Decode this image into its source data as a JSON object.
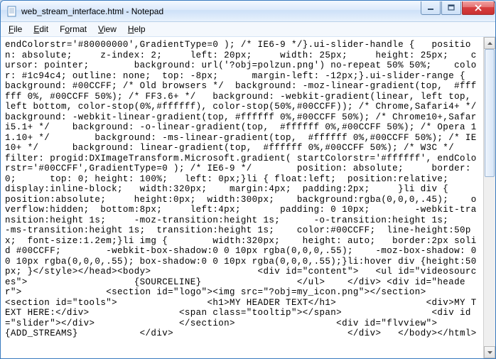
{
  "titlebar": {
    "app_name": "Notepad",
    "file_name": "web_stream_interface.html",
    "separator": " - "
  },
  "menu": {
    "file": "File",
    "edit": "Edit",
    "format": "Format",
    "view": "View",
    "help": "Help"
  },
  "icons": {
    "app": "notepad-icon",
    "minimize": "minimize-icon",
    "maximize": "maximize-icon",
    "close": "close-icon",
    "scroll_up": "scroll-up-arrow",
    "scroll_down": "scroll-down-arrow"
  },
  "editor": {
    "content": "endColorstr='#80000000',GradientType=0 ); /* IE6-9 */}.ui-slider-handle {   position: absolute;     z-index: 2;     left: 20px;     width: 25px;     height: 25px;    cursor: pointer;        background: url('?obj=polzun.png') no-repeat 50% 50%;    color: #1c94c4; outline: none;  top: -8px;      margin-left: -12px;}.ui-slider-range {  background: #00CCFF; /* Old browsers */  background: -moz-linear-gradient(top,  #ffffff 0%, #00CCFF 50%); /* FF3.6+ */   background: -webkit-gradient(linear, left top, left bottom, color-stop(0%,#ffffff), color-stop(50%,#00CCFF)); /* Chrome,Safari4+ */    background: -webkit-linear-gradient(top, #ffffff 0%,#00CCFF 50%); /* Chrome10+,Safari5.1+ */    background: -o-linear-gradient(top,  #ffffff 0%,#00CCFF 50%); /* Opera 11.10+ */        background: -ms-linear-gradient(top,  #ffffff 0%,#00CCFF 50%); /* IE10+ */      background: linear-gradient(top,  #ffffff 0%,#00CCFF 50%); /* W3C */    filter: progid:DXImageTransform.Microsoft.gradient( startColorstr='#ffffff', endColorstr='#00CCFF',GradientType=0 ); /* IE6-9 */        position: absolute;     border: 0;      top: 0; height: 100%;   left: 0px;}li { float:left;  position:relative;     display:inline-block;   width:320px;    margin:4px;  padding:2px;     }li div {        position:absolute;     height:0px;  width:300px;    background:rgba(0,0,0,.45);    overflow:hidden;  bottom:8px;     left:4px;       padding: 0 10px;        -webkit-transition:height 1s;     -moz-transition:height 1s;      -o-transition:height 1s;        -ms-transition:height 1s;  transition:height 1s;    color:#00CCFF;  line-height:50px;  font-size:1.2em;}li img {        width:320px;    height: auto;   border:2px solid #00CCFF;        -webkit-box-shadow:0 0 10px rgba(0,0,0,.55);    -moz-box-shadow: 0 0 10px rgba(0,0,0,.55); box-shadow:0 0 10px rgba(0,0,0,.55);}li:hover div {height:50px; }</style></head><body>                   <div id=\"content\">   <ul id=\"videosources\">                   {SOURCELINE}                 </ul>    </div> <div id=\"header\">               <section id=\"logo\"><img src=\"?obj=my_icon.png\"></section>                <section id=\"tools\">                <h1>MY HEADER TEXT</h1>                <div>MY TEXT HERE:</div>                <span class=\"tooltip\"></span>                <div id=\"slider\"></div>               </section>                  <div id=\"flvview\">               {ADD_STREAMS}           </div>                               </div>   </body></html>"
  }
}
